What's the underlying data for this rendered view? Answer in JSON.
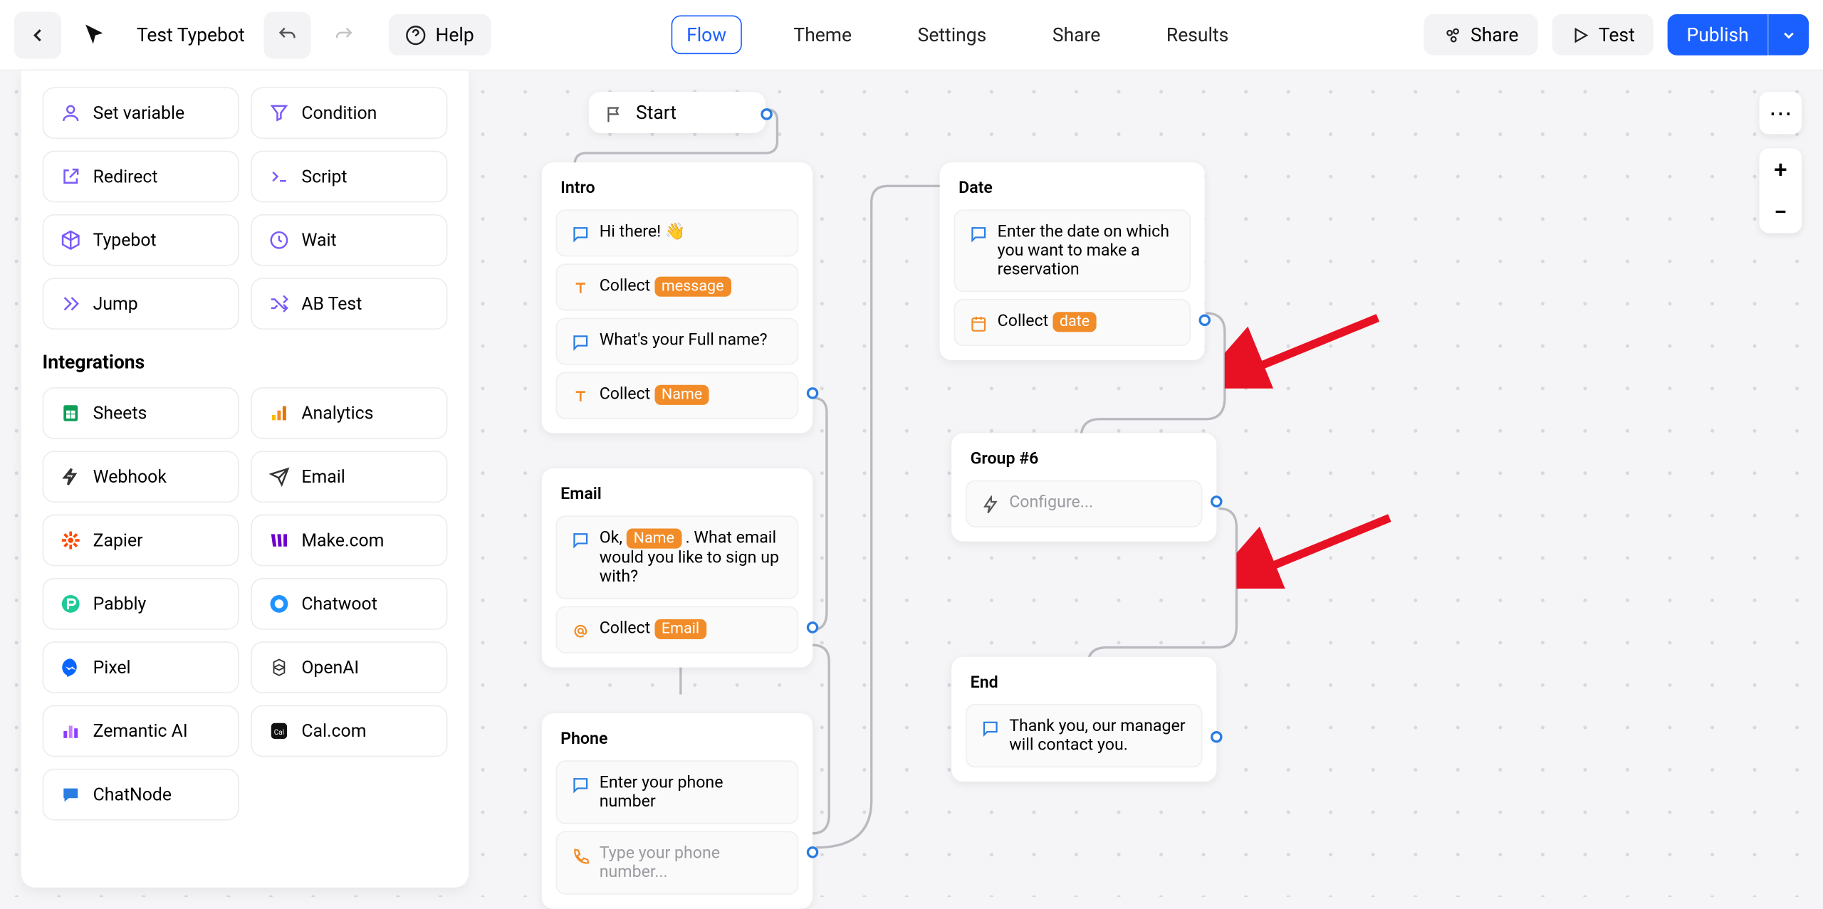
{
  "header": {
    "bot_name": "Test Typebot",
    "tabs": {
      "flow": "Flow",
      "theme": "Theme",
      "settings": "Settings",
      "share": "Share",
      "results": "Results"
    },
    "help": "Help",
    "share_btn": "Share",
    "test_btn": "Test",
    "publish_btn": "Publish"
  },
  "sidebar": {
    "logic": [
      {
        "label": "Set variable",
        "icon": "user-circle"
      },
      {
        "label": "Condition",
        "icon": "filter"
      },
      {
        "label": "Redirect",
        "icon": "external"
      },
      {
        "label": "Script",
        "icon": "terminal"
      },
      {
        "label": "Typebot",
        "icon": "box"
      },
      {
        "label": "Wait",
        "icon": "clock"
      },
      {
        "label": "Jump",
        "icon": "skip"
      },
      {
        "label": "AB Test",
        "icon": "shuffle"
      }
    ],
    "integrations_title": "Integrations",
    "integrations": [
      {
        "label": "Sheets",
        "color": "#0f9d58"
      },
      {
        "label": "Analytics",
        "color": "#f4b400"
      },
      {
        "label": "Webhook",
        "color": "#333"
      },
      {
        "label": "Email",
        "color": "#333"
      },
      {
        "label": "Zapier",
        "color": "#ff4a00"
      },
      {
        "label": "Make.com",
        "color": "#6d00cc"
      },
      {
        "label": "Pabbly",
        "color": "#20c997"
      },
      {
        "label": "Chatwoot",
        "color": "#1f93ff"
      },
      {
        "label": "Pixel",
        "color": "#0866ff"
      },
      {
        "label": "OpenAI",
        "color": "#333"
      },
      {
        "label": "Zemantic AI",
        "color": "#8a3ffc"
      },
      {
        "label": "Cal.com",
        "color": "#111"
      },
      {
        "label": "ChatNode",
        "color": "#2a7de1"
      }
    ]
  },
  "flow": {
    "start": "Start",
    "intro": {
      "title": "Intro",
      "hi": "Hi there! 👋",
      "collect_msg_prefix": "Collect ",
      "msg_var": "message",
      "q_name": "What's your Full name?",
      "name_var": "Name"
    },
    "email": {
      "title": "Email",
      "msg_a": "Ok, ",
      "msg_b": " . What email would you like to sign up with?",
      "email_var": "Email",
      "collect_prefix": "Collect "
    },
    "phone": {
      "title": "Phone",
      "prompt": "Enter your phone number",
      "placeholder": "Type your phone number..."
    },
    "date": {
      "title": "Date",
      "prompt": "Enter the date on which you want to make a reservation",
      "collect_prefix": "Collect ",
      "date_var": "date"
    },
    "group6": {
      "title": "Group #6",
      "configure": "Configure..."
    },
    "end": {
      "title": "End",
      "msg": "Thank you, our manager will contact you."
    }
  }
}
